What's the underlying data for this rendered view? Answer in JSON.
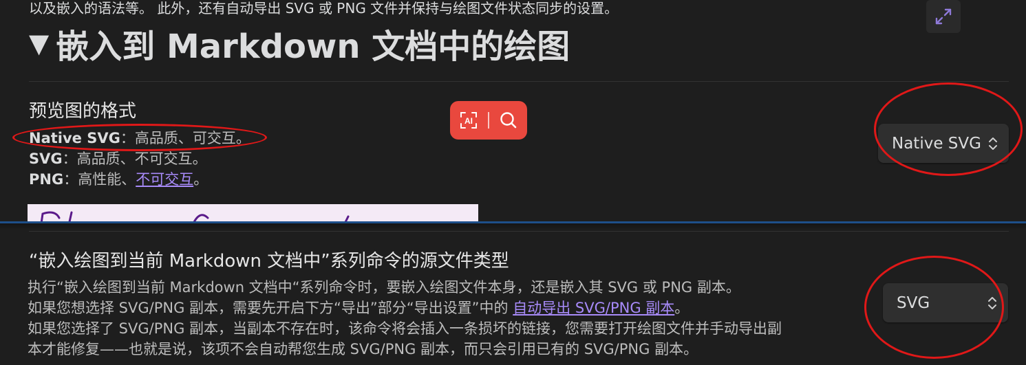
{
  "intro_text": "以及嵌入的语法等。 此外，还有自动导出 SVG 或 PNG 文件并保持与绘图文件状态同步的设置。",
  "section": {
    "toggle_glyph": "▼",
    "title": "嵌入到 Markdown 文档中的绘图"
  },
  "preview_format": {
    "name": "预览图的格式",
    "lines": [
      {
        "bold": "Native SVG",
        "text": "：高品质、可交互。"
      },
      {
        "bold": "SVG",
        "text": "：高品质、不可交互。"
      },
      {
        "bold": "PNG",
        "text": "：高性能、",
        "link": "不可交互",
        "tail": "。"
      }
    ],
    "selected": "Native SVG"
  },
  "embed_source": {
    "name": "“嵌入绘图到当前 Markdown 文档中”系列命令的源文件类型",
    "line1": "执行“嵌入绘图到当前 Markdown 文档中“系列命令时，要嵌入绘图文件本身，还是嵌入其 SVG 或 PNG 副本。",
    "line2_pre": "如果您想选择 SVG/PNG 副本，需要先开启下方“导出”部分“导出设置”中的 ",
    "line2_link": "自动导出 SVG/PNG 副本",
    "line2_post": "。",
    "line3": "如果您选择了 SVG/PNG 副本，当副本不存在时，该命令将会插入一条损坏的链接，您需要打开绘图文件并手动导出副",
    "line4": "本才能修复——也就是说，该项不会自动帮您生成 SVG/PNG 副本，而只会引用已有的 SVG/PNG 副本。",
    "selected": "SVG"
  },
  "icons": {
    "expand": "expand-diagonal-icon",
    "ai": "ai-scan-icon",
    "search": "search-icon",
    "chevron": "chevron-updown-icon"
  },
  "colors": {
    "background": "#1e1e1e",
    "link": "#a88bfa",
    "ai_pill": "#e9483e",
    "annotation": "#e01818",
    "divider_accent": "#1e4f8a"
  }
}
